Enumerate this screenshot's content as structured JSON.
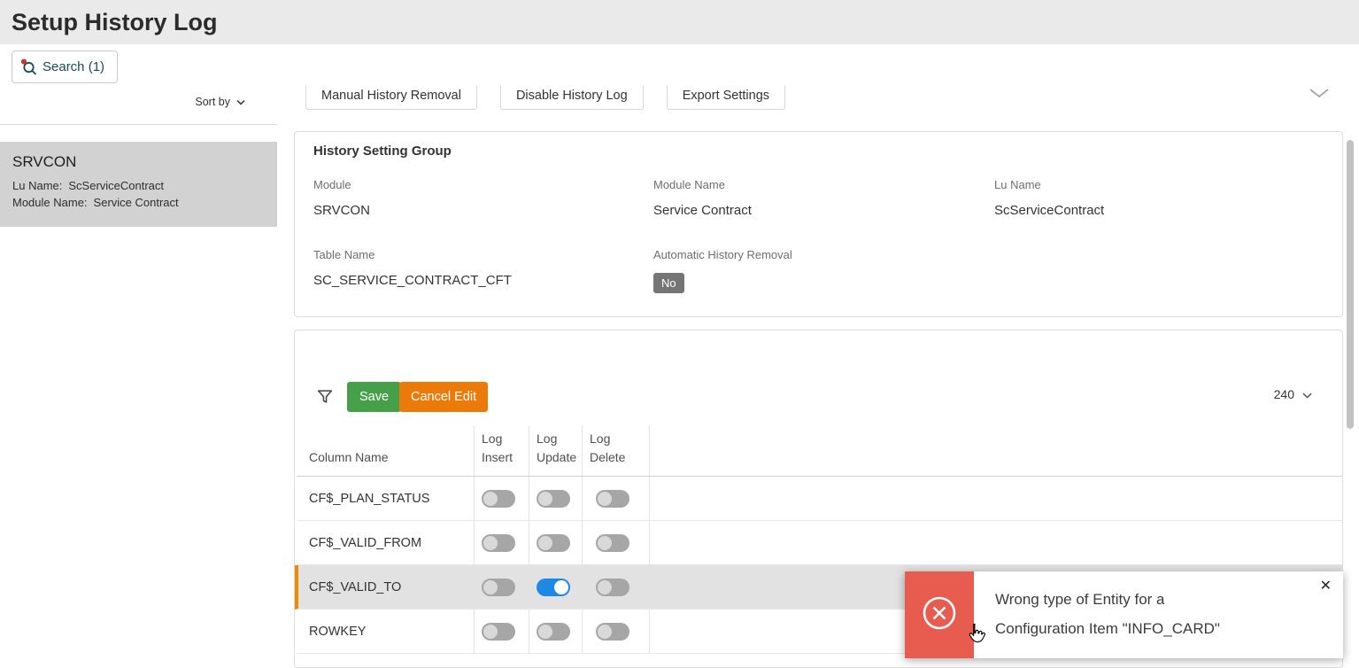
{
  "colors": {
    "header_bg": "#eaeaea",
    "save_green": "#46a049",
    "cancel_orange": "#ec7a08",
    "toggle_on_blue": "#1e88e5",
    "toast_red": "#e85c50",
    "selected_row_accent": "#ed8b00",
    "badge_gray": "#757575"
  },
  "header": {
    "title": "Setup History Log"
  },
  "search": {
    "label": "Search (1)"
  },
  "sidebar": {
    "sort_label": "Sort by",
    "item": {
      "title": "SRVCON",
      "lu_name_label": "Lu Name:",
      "lu_name_value": "ScServiceContract",
      "module_name_label": "Module Name:",
      "module_name_value": "Service Contract"
    }
  },
  "tabs": [
    "Manual History Removal",
    "Disable History Log",
    "Export Settings"
  ],
  "history_group": {
    "title": "History Setting Group",
    "fields": [
      {
        "label": "Module",
        "value": "SRVCON"
      },
      {
        "label": "Module Name",
        "value": "Service Contract"
      },
      {
        "label": "Lu Name",
        "value": "ScServiceContract"
      },
      {
        "label": "Table Name",
        "value": "SC_SERVICE_CONTRACT_CFT"
      },
      {
        "label": "Automatic History Removal",
        "value": "No"
      }
    ]
  },
  "table": {
    "save_label": "Save",
    "cancel_label": "Cancel Edit",
    "page_size": "240",
    "columns": [
      "Column Name",
      "Log Insert",
      "Log Update",
      "Log Delete"
    ],
    "rows": [
      {
        "name": "CF$_PLAN_STATUS",
        "insert": false,
        "update": false,
        "delete": false,
        "selected": false
      },
      {
        "name": "CF$_VALID_FROM",
        "insert": false,
        "update": false,
        "delete": false,
        "selected": false
      },
      {
        "name": "CF$_VALID_TO",
        "insert": false,
        "update": true,
        "delete": false,
        "selected": true
      },
      {
        "name": "ROWKEY",
        "insert": false,
        "update": false,
        "delete": false,
        "selected": false
      }
    ]
  },
  "toast": {
    "message": "Wrong type of Entity for a Configuration Item \"INFO_CARD\"",
    "close_label": "✕"
  }
}
